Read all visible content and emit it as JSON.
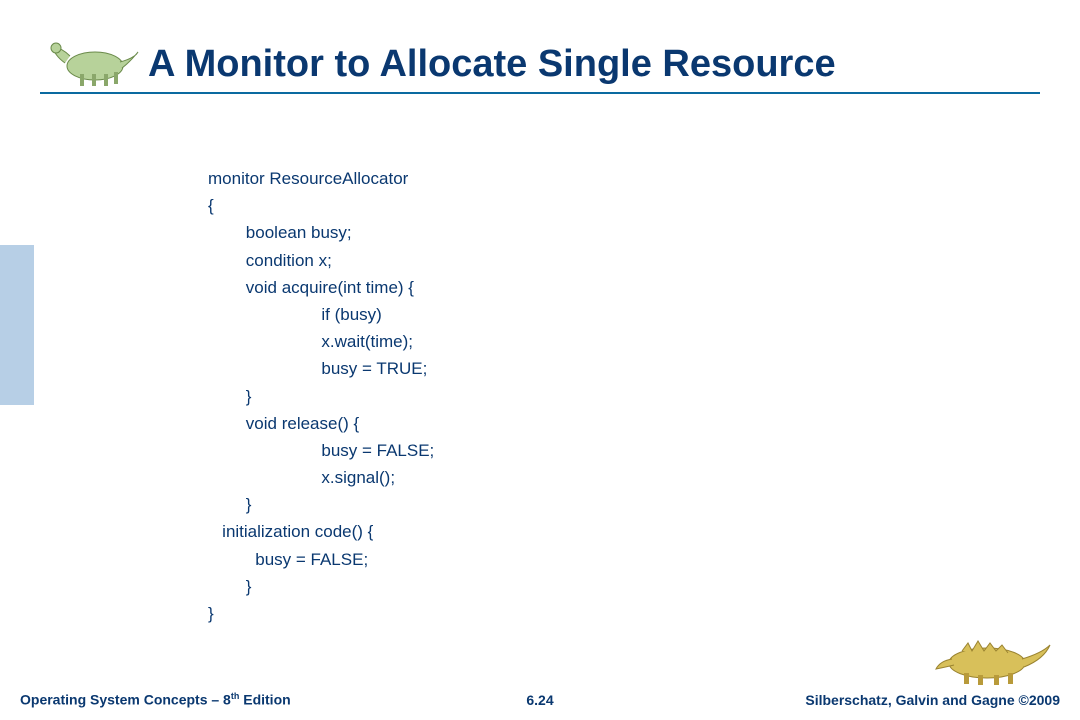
{
  "title": "A Monitor to Allocate Single Resource",
  "code": "monitor ResourceAllocator\n{ \n\tboolean busy; \n\tcondition x; \n\tvoid acquire(int time) { \n\t\t\tif (busy) \n\t\t\tx.wait(time); \n\t\t\tbusy = TRUE; \n\t} \n\tvoid release() { \n\t\t\tbusy = FALSE; \n\t\t\tx.signal(); \n\t} \n   initialization code() {\n\t  busy = FALSE; \n\t}\n}",
  "footer": {
    "left_prefix": "Operating System Concepts – 8",
    "left_suffix": " Edition",
    "left_ord": "th",
    "center": "6.24",
    "right": "Silberschatz, Galvin and Gagne ©2009"
  }
}
